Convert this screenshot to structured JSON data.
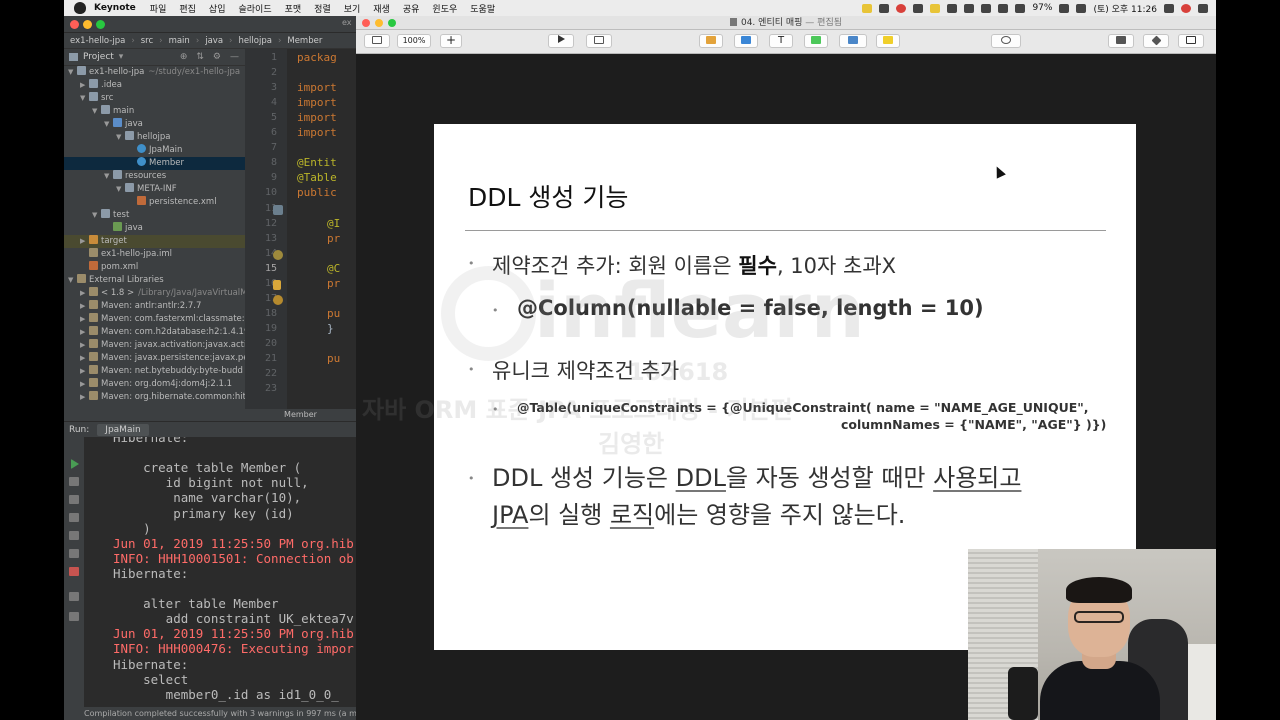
{
  "menubar": {
    "app_name": "Keynote",
    "items": [
      "파일",
      "편집",
      "삽입",
      "슬라이드",
      "포맷",
      "정렬",
      "보기",
      "재생",
      "공유",
      "윈도우",
      "도움말"
    ],
    "battery": "97%",
    "clock": "(토) 오후 11:26"
  },
  "ide": {
    "title_tab": "ex",
    "breadcrumb": [
      "ex1-hello-jpa",
      "src",
      "main",
      "java",
      "hellojpa",
      "Member"
    ],
    "project_label": "Project",
    "tree": [
      {
        "label": "ex1-hello-jpa",
        "extra": "~/study/ex1-hello-jpa",
        "depth": 0,
        "arrow": "down",
        "icon": "folder"
      },
      {
        "label": ".idea",
        "depth": 1,
        "arrow": "right",
        "icon": "folder"
      },
      {
        "label": "src",
        "depth": 1,
        "arrow": "down",
        "icon": "folder"
      },
      {
        "label": "main",
        "depth": 2,
        "arrow": "down",
        "icon": "folder"
      },
      {
        "label": "java",
        "depth": 3,
        "arrow": "down",
        "icon": "folder-blue"
      },
      {
        "label": "hellojpa",
        "depth": 4,
        "arrow": "down",
        "icon": "folder"
      },
      {
        "label": "JpaMain",
        "depth": 5,
        "arrow": "",
        "icon": "cls"
      },
      {
        "label": "Member",
        "depth": 5,
        "arrow": "",
        "icon": "cls",
        "selected": true
      },
      {
        "label": "resources",
        "depth": 3,
        "arrow": "down",
        "icon": "folder"
      },
      {
        "label": "META-INF",
        "depth": 4,
        "arrow": "down",
        "icon": "folder"
      },
      {
        "label": "persistence.xml",
        "depth": 5,
        "arrow": "",
        "icon": "xml"
      },
      {
        "label": "test",
        "depth": 2,
        "arrow": "down",
        "icon": "folder"
      },
      {
        "label": "java",
        "depth": 3,
        "arrow": "",
        "icon": "folder-green"
      },
      {
        "label": "target",
        "depth": 1,
        "arrow": "right",
        "icon": "folder-orange",
        "highlight": true
      },
      {
        "label": "ex1-hello-jpa.iml",
        "depth": 1,
        "arrow": "",
        "icon": "lib"
      },
      {
        "label": "pom.xml",
        "depth": 1,
        "arrow": "",
        "icon": "xml"
      },
      {
        "label": "External Libraries",
        "depth": 0,
        "arrow": "down",
        "icon": "lib"
      },
      {
        "label": "< 1.8 >",
        "extra": "/Library/Java/JavaVirtualM",
        "depth": 1,
        "arrow": "right",
        "icon": "lib"
      },
      {
        "label": "Maven: antlr:antlr:2.7.7",
        "depth": 1,
        "arrow": "right",
        "icon": "lib"
      },
      {
        "label": "Maven: com.fasterxml:classmate:",
        "depth": 1,
        "arrow": "right",
        "icon": "lib"
      },
      {
        "label": "Maven: com.h2database:h2:1.4.19",
        "depth": 1,
        "arrow": "right",
        "icon": "lib"
      },
      {
        "label": "Maven: javax.activation:javax.activ",
        "depth": 1,
        "arrow": "right",
        "icon": "lib"
      },
      {
        "label": "Maven: javax.persistence:javax.pe",
        "depth": 1,
        "arrow": "right",
        "icon": "lib"
      },
      {
        "label": "Maven: net.bytebuddy:byte-budd",
        "depth": 1,
        "arrow": "right",
        "icon": "lib"
      },
      {
        "label": "Maven: org.dom4j:dom4j:2.1.1",
        "depth": 1,
        "arrow": "right",
        "icon": "lib"
      },
      {
        "label": "Maven: org.hibernate.common:hit",
        "depth": 1,
        "arrow": "right",
        "icon": "lib"
      }
    ],
    "line_numbers": [
      "1",
      "2",
      "3",
      "4",
      "5",
      "6",
      "7",
      "8",
      "9",
      "10",
      "11",
      "12",
      "13",
      "14",
      "15",
      "16",
      "17",
      "18",
      "19",
      "20",
      "21",
      "22",
      "23"
    ],
    "current_line": "15",
    "code_lines": [
      {
        "line": 1,
        "text": "packag",
        "kind": "kw"
      },
      {
        "line": 3,
        "text": "import",
        "kind": "kw"
      },
      {
        "line": 4,
        "text": "import",
        "kind": "kw"
      },
      {
        "line": 5,
        "text": "import",
        "kind": "kw"
      },
      {
        "line": 6,
        "text": "import",
        "kind": "kw"
      },
      {
        "line": 8,
        "text": "@Entit",
        "kind": "ann"
      },
      {
        "line": 9,
        "text": "@Table",
        "kind": "ann"
      },
      {
        "line": 10,
        "text": "public",
        "kind": "kw"
      },
      {
        "line": 12,
        "text": "@I",
        "kind": "ann"
      },
      {
        "line": 13,
        "text": "pr",
        "kind": "kw"
      },
      {
        "line": 15,
        "text": "@C",
        "kind": "ann"
      },
      {
        "line": 16,
        "text": "pr",
        "kind": "kw"
      },
      {
        "line": 18,
        "text": "pu",
        "kind": "kw"
      },
      {
        "line": 19,
        "text": "}",
        "kind": "plain"
      },
      {
        "line": 21,
        "text": "pu",
        "kind": "kw"
      }
    ],
    "editor_tab": "Member",
    "run_label": "Run:",
    "run_tab": "JpaMain",
    "console": [
      {
        "text": "Hibernate:",
        "color": "plain"
      },
      {
        "text": "",
        "color": "plain"
      },
      {
        "text": "    create table Member (",
        "color": "plain"
      },
      {
        "text": "       id bigint not null,",
        "color": "plain"
      },
      {
        "text": "        name varchar(10),",
        "color": "plain"
      },
      {
        "text": "        primary key (id)",
        "color": "plain"
      },
      {
        "text": "    )",
        "color": "plain"
      },
      {
        "text": "Jun 01, 2019 11:25:50 PM org.hib",
        "color": "red"
      },
      {
        "text": "INFO: HHH10001501: Connection ob",
        "color": "red"
      },
      {
        "text": "Hibernate:",
        "color": "plain"
      },
      {
        "text": "",
        "color": "plain"
      },
      {
        "text": "    alter table Member",
        "color": "plain"
      },
      {
        "text": "       add constraint UK_ektea7v",
        "color": "plain"
      },
      {
        "text": "Jun 01, 2019 11:25:50 PM org.hib",
        "color": "red"
      },
      {
        "text": "INFO: HHH000476: Executing impor",
        "color": "red"
      },
      {
        "text": "Hibernate:",
        "color": "plain"
      },
      {
        "text": "    select",
        "color": "plain"
      },
      {
        "text": "       member0_.id as id1_0_0_",
        "color": "plain"
      }
    ],
    "status": "Compilation completed successfully with 3 warnings in 997 ms (a minute ag"
  },
  "keynote": {
    "title_doc": "04. 엔티티 매핑",
    "title_state": "— 편집됨",
    "zoom": "100%",
    "slide": {
      "title": "DDL 생성 기능",
      "bullet1_pre": "제약조건 추가: 회원 이름은 ",
      "bullet1_bold": "필수",
      "bullet1_post": ", 10자 초과X",
      "bullet1_sub": "@Column(nullable = false, length = 10)",
      "bullet2": "유니크 제약조건 추가",
      "bullet2_sub_line1": "@Table(uniqueConstraints = {@UniqueConstraint( name = \"NAME_AGE_UNIQUE\",",
      "bullet2_sub_line2": "columnNames = {\"NAME\", \"AGE\"} )})",
      "bullet3_seg1": "DDL 생성 기능은 ",
      "bullet3_seg2": "DDL",
      "bullet3_seg3": "을 자동 생성할 때만 ",
      "bullet3_seg4": "사용되고",
      "bullet3_seg5": "JPA",
      "bullet3_seg6": "의 실행 ",
      "bullet3_seg7": "로직",
      "bullet3_seg8": "에는 영향을 주지 않는다."
    },
    "watermark": {
      "brand": "inflearn",
      "code": "165618",
      "course": "자바 ORM 표준 JPA 프로그래밍 - 기본편",
      "author": "김영한"
    }
  },
  "colors": {
    "ide_bg": "#2b2b2b",
    "ide_panel": "#3c3f41",
    "keyword": "#cc7832",
    "annotation": "#bbb529",
    "console_red": "#ff6b68",
    "slide_bg": "#ffffff"
  }
}
